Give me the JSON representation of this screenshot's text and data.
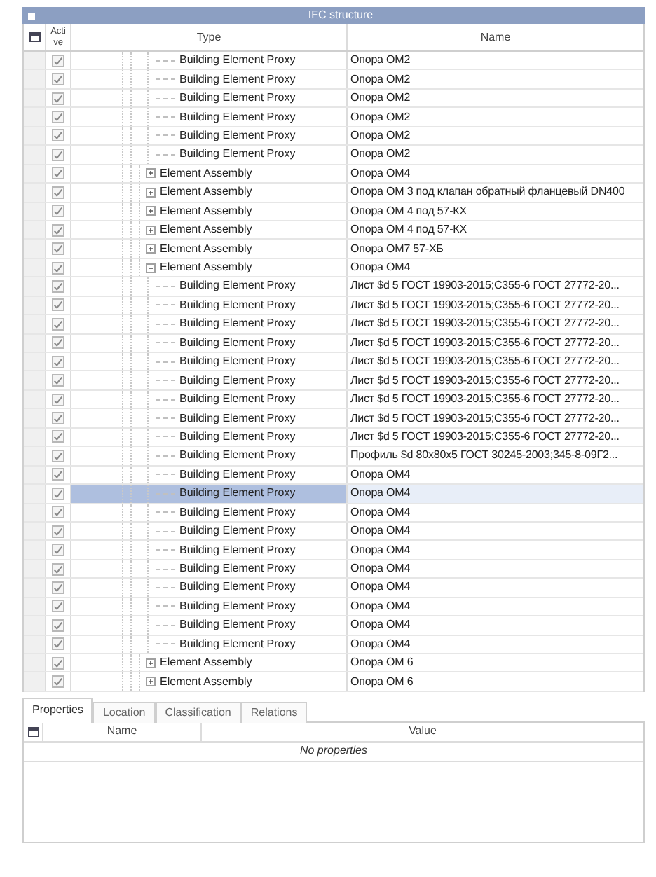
{
  "title": "IFC structure",
  "columns": [
    "Acti ve",
    "Type",
    "Name"
  ],
  "rows": [
    {
      "kind": "proxy",
      "type": "Building Element Proxy",
      "name": "Опора OM2",
      "active": true,
      "selected": false
    },
    {
      "kind": "proxy",
      "type": "Building Element Proxy",
      "name": "Опора OM2",
      "active": true,
      "selected": false
    },
    {
      "kind": "proxy",
      "type": "Building Element Proxy",
      "name": "Опора OM2",
      "active": true,
      "selected": false
    },
    {
      "kind": "proxy",
      "type": "Building Element Proxy",
      "name": "Опора OM2",
      "active": true,
      "selected": false
    },
    {
      "kind": "proxy",
      "type": "Building Element Proxy",
      "name": "Опора OM2",
      "active": true,
      "selected": false
    },
    {
      "kind": "proxy",
      "type": "Building Element Proxy",
      "name": "Опора OM2",
      "active": true,
      "selected": false
    },
    {
      "kind": "assembly",
      "type": "Element Assembly",
      "name": "Опора OM4",
      "active": true,
      "selected": false,
      "expanded": false
    },
    {
      "kind": "assembly",
      "type": "Element Assembly",
      "name": "Опора OM 3 под клапан обратный фланцевый DN400",
      "active": true,
      "selected": false,
      "expanded": false
    },
    {
      "kind": "assembly",
      "type": "Element Assembly",
      "name": "Опора OM 4 под 57-КХ",
      "active": true,
      "selected": false,
      "expanded": false
    },
    {
      "kind": "assembly",
      "type": "Element Assembly",
      "name": "Опора OM 4 под 57-КХ",
      "active": true,
      "selected": false,
      "expanded": false
    },
    {
      "kind": "assembly",
      "type": "Element Assembly",
      "name": "Опора OM7 57-ХБ",
      "active": true,
      "selected": false,
      "expanded": false
    },
    {
      "kind": "assembly",
      "type": "Element Assembly",
      "name": "Опора OM4",
      "active": true,
      "selected": false,
      "expanded": true,
      "children": [
        {
          "kind": "proxy",
          "type": "Building Element Proxy",
          "name": "Лист $d 5 ГОСТ 19903-2015;С355-6 ГОСТ 27772-20...",
          "active": true,
          "selected": false
        },
        {
          "kind": "proxy",
          "type": "Building Element Proxy",
          "name": "Лист $d 5 ГОСТ 19903-2015;С355-6 ГОСТ 27772-20...",
          "active": true,
          "selected": false
        },
        {
          "kind": "proxy",
          "type": "Building Element Proxy",
          "name": "Лист $d 5 ГОСТ 19903-2015;С355-6 ГОСТ 27772-20...",
          "active": true,
          "selected": false
        },
        {
          "kind": "proxy",
          "type": "Building Element Proxy",
          "name": "Лист $d 5 ГОСТ 19903-2015;С355-6 ГОСТ 27772-20...",
          "active": true,
          "selected": false
        },
        {
          "kind": "proxy",
          "type": "Building Element Proxy",
          "name": "Лист $d 5 ГОСТ 19903-2015;С355-6 ГОСТ 27772-20...",
          "active": true,
          "selected": false
        },
        {
          "kind": "proxy",
          "type": "Building Element Proxy",
          "name": "Лист $d 5 ГОСТ 19903-2015;С355-6 ГОСТ 27772-20...",
          "active": true,
          "selected": false
        },
        {
          "kind": "proxy",
          "type": "Building Element Proxy",
          "name": "Лист $d 5 ГОСТ 19903-2015;С355-6 ГОСТ 27772-20...",
          "active": true,
          "selected": false
        },
        {
          "kind": "proxy",
          "type": "Building Element Proxy",
          "name": "Лист $d 5 ГОСТ 19903-2015;С355-6 ГОСТ 27772-20...",
          "active": true,
          "selected": false
        },
        {
          "kind": "proxy",
          "type": "Building Element Proxy",
          "name": "Лист $d 5 ГОСТ 19903-2015;С355-6 ГОСТ 27772-20...",
          "active": true,
          "selected": false
        },
        {
          "kind": "proxy",
          "type": "Building Element Proxy",
          "name": "Профиль $d 80x80x5 ГОСТ 30245-2003;345-8-09Г2...",
          "active": true,
          "selected": false
        },
        {
          "kind": "proxy",
          "type": "Building Element Proxy",
          "name": "Опора OM4",
          "active": true,
          "selected": false
        },
        {
          "kind": "proxy",
          "type": "Building Element Proxy",
          "name": "Опора OM4",
          "active": true,
          "selected": true
        },
        {
          "kind": "proxy",
          "type": "Building Element Proxy",
          "name": "Опора OM4",
          "active": true,
          "selected": false
        },
        {
          "kind": "proxy",
          "type": "Building Element Proxy",
          "name": "Опора OM4",
          "active": true,
          "selected": false
        },
        {
          "kind": "proxy",
          "type": "Building Element Proxy",
          "name": "Опора OM4",
          "active": true,
          "selected": false
        },
        {
          "kind": "proxy",
          "type": "Building Element Proxy",
          "name": "Опора OM4",
          "active": true,
          "selected": false
        },
        {
          "kind": "proxy",
          "type": "Building Element Proxy",
          "name": "Опора OM4",
          "active": true,
          "selected": false
        },
        {
          "kind": "proxy",
          "type": "Building Element Proxy",
          "name": "Опора OM4",
          "active": true,
          "selected": false
        },
        {
          "kind": "proxy",
          "type": "Building Element Proxy",
          "name": "Опора OM4",
          "active": true,
          "selected": false
        },
        {
          "kind": "proxy",
          "type": "Building Element Proxy",
          "name": "Опора OM4",
          "active": true,
          "selected": false
        }
      ]
    },
    {
      "kind": "assembly",
      "type": "Element Assembly",
      "name": "Опора OM 6",
      "active": true,
      "selected": false,
      "expanded": false
    },
    {
      "kind": "assembly",
      "type": "Element Assembly",
      "name": "Опора OM 6",
      "active": true,
      "selected": false,
      "expanded": false
    }
  ],
  "tabs": [
    {
      "label": "Properties",
      "selected": true
    },
    {
      "label": "Location",
      "selected": false
    },
    {
      "label": "Classification",
      "selected": false
    },
    {
      "label": "Relations",
      "selected": false
    }
  ],
  "properties": {
    "columns": [
      "Name",
      "Value"
    ],
    "empty_text": "No properties"
  }
}
